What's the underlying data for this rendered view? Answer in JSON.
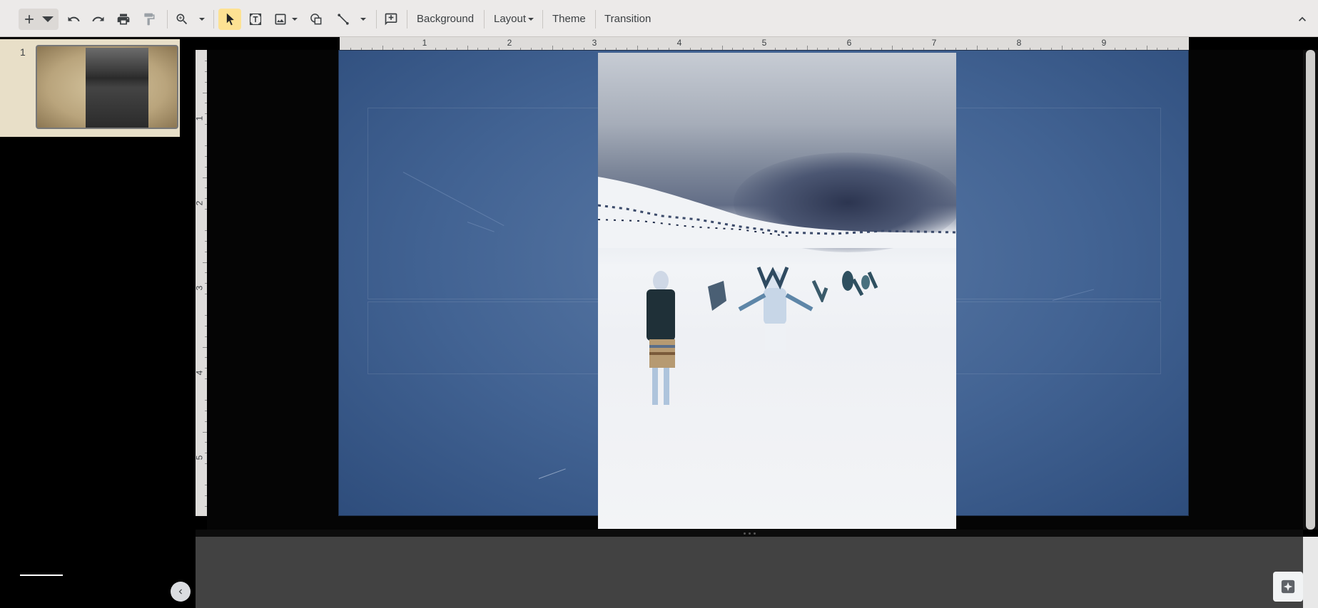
{
  "toolbar": {
    "icons": [
      "add-icon",
      "chevron-down-icon",
      "undo-icon",
      "redo-icon",
      "print-icon",
      "paint-format-icon",
      "zoom-icon",
      "chevron-down-icon",
      "select-arrow-icon",
      "text-box-icon",
      "image-icon",
      "chevron-down-icon",
      "shape-icon",
      "line-icon",
      "chevron-down-icon",
      "comment-add-icon",
      "collapse-up-icon"
    ],
    "background_label": "Background",
    "layout_label": "Layout",
    "theme_label": "Theme",
    "transition_label": "Transition"
  },
  "filmstrip": {
    "slides": [
      {
        "number": "1"
      }
    ]
  },
  "ruler": {
    "horizontal_labels": [
      "1",
      "2",
      "3",
      "4",
      "5",
      "6",
      "7",
      "8",
      "9"
    ],
    "vertical_labels": [
      "1",
      "2",
      "3",
      "4",
      "5"
    ]
  },
  "colors": {
    "toolbar_bg": "#eceae9",
    "selected_tool": "#fde293",
    "slide_bg": "#426393",
    "filmstrip_selected": "#e8dfc8"
  }
}
